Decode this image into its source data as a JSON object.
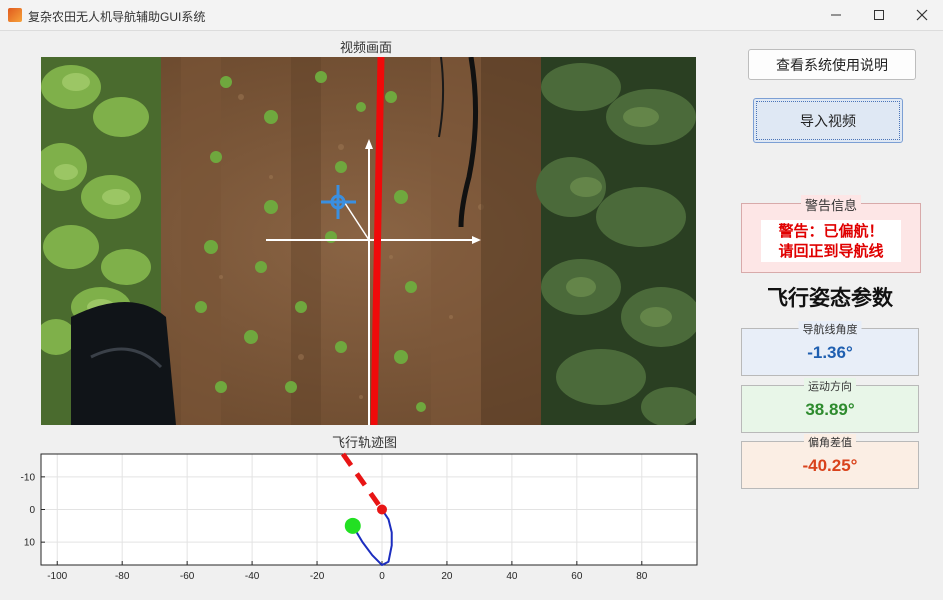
{
  "window": {
    "title": "复杂农田无人机导航辅助GUI系统",
    "controls": [
      "minimize",
      "maximize",
      "close"
    ]
  },
  "video_panel": {
    "title": "视频画面"
  },
  "trajectory_panel": {
    "title": "飞行轨迹图"
  },
  "buttons": {
    "help_label": "查看系统使用说明",
    "import_label": "导入视频"
  },
  "warning": {
    "legend": "警告信息",
    "line1": "警告：已偏航！",
    "line2": "请回正到导航线"
  },
  "flight": {
    "heading": "飞行姿态参数",
    "params": [
      {
        "label": "导航线角度",
        "value": "-1.36°",
        "color": "#1f5fb0",
        "bg": "#e8eef8"
      },
      {
        "label": "运动方向",
        "value": "38.89°",
        "color": "#2e8b2e",
        "bg": "#e8f6e8"
      },
      {
        "label": "偏角差值",
        "value": "-40.25°",
        "color": "#d9431c",
        "bg": "#fbeee4"
      }
    ]
  },
  "chart_data": {
    "type": "line",
    "title": "飞行轨迹图",
    "xlim": [
      -105,
      97
    ],
    "ylim": [
      17,
      -17
    ],
    "y_reversed": true,
    "x_ticks": [
      -100,
      -80,
      -60,
      -40,
      -20,
      0,
      20,
      40,
      60,
      80
    ],
    "y_ticks": [
      -10,
      0,
      10
    ],
    "grid": true,
    "series": [
      {
        "role": "navigation-line",
        "color": "#e81515",
        "style": "dashed",
        "x": [
          -12,
          0
        ],
        "y": [
          -17,
          0
        ]
      },
      {
        "role": "trajectory",
        "color": "#1c2dbf",
        "style": "solid",
        "x": [
          0,
          2,
          3,
          3,
          2,
          0,
          -3,
          -6,
          -9
        ],
        "y": [
          0,
          3,
          7,
          11,
          16,
          17,
          14,
          10,
          5
        ]
      }
    ],
    "markers": [
      {
        "role": "start-point",
        "x": -9,
        "y": 5,
        "color": "#22e022"
      },
      {
        "role": "current-position",
        "x": 0,
        "y": 0,
        "color": "#e81515"
      }
    ]
  }
}
